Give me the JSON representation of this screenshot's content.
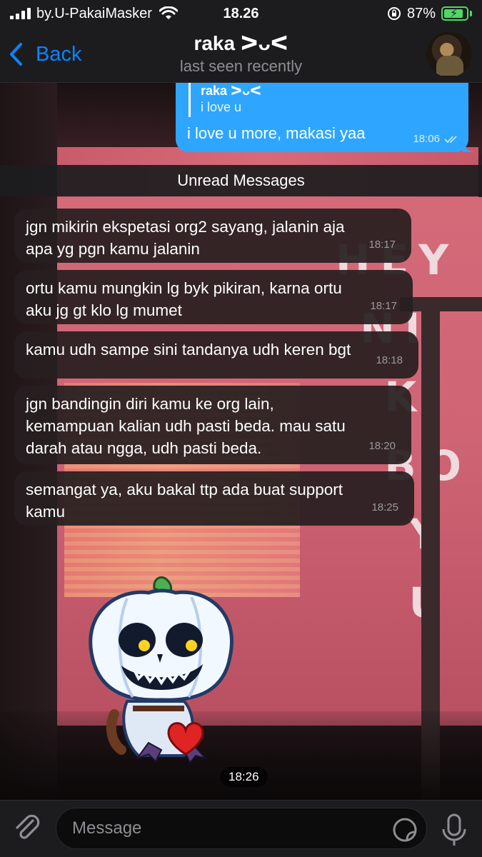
{
  "status_bar": {
    "carrier": "by.U-PakaiMasker",
    "time": "18.26",
    "battery": "87%",
    "battery_level": 0.87
  },
  "header": {
    "back_label": "Back",
    "title": "raka ᐳᴗᐸ",
    "subtitle": "last seen recently"
  },
  "outgoing": {
    "reply_name": "raka ᐳᴗᐸ",
    "reply_text": "i love u",
    "text": "i love u more, makasi yaa",
    "time": "18:06"
  },
  "unread_label": "Unread Messages",
  "messages": [
    {
      "line1": "jgn mikirin ekspetasi org2 sayang, jalanin aja",
      "line2": "apa yg pgn kamu jalanin",
      "line3": "",
      "time": "18:17"
    },
    {
      "line1": "ortu kamu mungkin lg byk pikiran, karna ortu",
      "line2": "aku jg gt klo lg mumet",
      "line3": "",
      "time": "18:17"
    },
    {
      "line1": "kamu udh sampe sini tandanya udh keren bgt",
      "line2": "",
      "line3": "",
      "time": "18:18"
    },
    {
      "line1": "jgn bandingin diri kamu ke org lain,",
      "line2": "kemampuan kalian udh pasti beda. mau satu",
      "line3": "darah atau ngga, udh pasti beda.",
      "time": "18:20"
    },
    {
      "line1": "semangat ya, aku bakal ttp ada buat support",
      "line2": "kamu",
      "line3": "",
      "time": "18:25"
    }
  ],
  "sticker": {
    "time": "18:26"
  },
  "background_letters": "HEY\nNI\nK\nBO\nY\nU",
  "input": {
    "placeholder": "Message"
  },
  "colors": {
    "accent": "#0a84ff",
    "outgoing_bubble": "#2ea6ff",
    "battery": "#4cd964"
  }
}
